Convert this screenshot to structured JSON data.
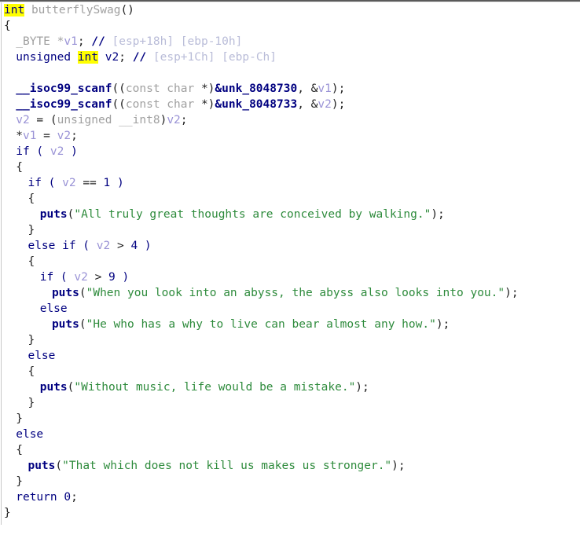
{
  "view": {
    "name": "hex-rays-pseudocode",
    "function_name": "butterflySwag",
    "background_color": "#ffffff",
    "highlight_color": "#ffff00",
    "string_color": "#2e8b3c",
    "keyword_color": "#000080",
    "variable_color": "#9a93d6",
    "comment_color": "#b9bcd8",
    "type_color": "#a0a0a0"
  },
  "code": {
    "lines": [
      {
        "indent": 0,
        "tokens": [
          {
            "t": "int",
            "c": "hl"
          },
          {
            "t": " ",
            "c": "plain"
          },
          {
            "t": "butterflySwag",
            "c": "type"
          },
          {
            "t": "()",
            "c": "plain"
          }
        ]
      },
      {
        "indent": 0,
        "tokens": [
          {
            "t": "{",
            "c": "plain"
          }
        ]
      },
      {
        "indent": 1,
        "tokens": [
          {
            "t": "_BYTE *",
            "c": "type"
          },
          {
            "t": "v1",
            "c": "var"
          },
          {
            "t": "; ",
            "c": "plain"
          },
          {
            "t": "//",
            "c": "cmt-mark"
          },
          {
            "t": " [esp+18h] [ebp-10h]",
            "c": "cmt"
          }
        ]
      },
      {
        "indent": 1,
        "tokens": [
          {
            "t": "unsigned ",
            "c": "kw"
          },
          {
            "t": "int",
            "c": "hl"
          },
          {
            "t": " ",
            "c": "plain"
          },
          {
            "t": "v2",
            "c": "kw"
          },
          {
            "t": "; ",
            "c": "plain"
          },
          {
            "t": "//",
            "c": "cmt-mark"
          },
          {
            "t": " [esp+1Ch] [ebp-Ch]",
            "c": "cmt"
          }
        ]
      },
      {
        "indent": 0,
        "tokens": [
          {
            "t": "",
            "c": "plain"
          }
        ]
      },
      {
        "indent": 1,
        "tokens": [
          {
            "t": "__isoc99_scanf",
            "c": "fn"
          },
          {
            "t": "((",
            "c": "plain"
          },
          {
            "t": "const char ",
            "c": "type"
          },
          {
            "t": "*)",
            "c": "plain"
          },
          {
            "t": "&unk_8048730",
            "c": "glob"
          },
          {
            "t": ", &",
            "c": "plain"
          },
          {
            "t": "v1",
            "c": "var"
          },
          {
            "t": ");",
            "c": "plain"
          }
        ]
      },
      {
        "indent": 1,
        "tokens": [
          {
            "t": "__isoc99_scanf",
            "c": "fn"
          },
          {
            "t": "((",
            "c": "plain"
          },
          {
            "t": "const char ",
            "c": "type"
          },
          {
            "t": "*)",
            "c": "plain"
          },
          {
            "t": "&unk_8048733",
            "c": "glob"
          },
          {
            "t": ", &",
            "c": "plain"
          },
          {
            "t": "v2",
            "c": "var"
          },
          {
            "t": ");",
            "c": "plain"
          }
        ]
      },
      {
        "indent": 1,
        "tokens": [
          {
            "t": "v2",
            "c": "var"
          },
          {
            "t": " = (",
            "c": "plain"
          },
          {
            "t": "unsigned __int8",
            "c": "type"
          },
          {
            "t": ")",
            "c": "plain"
          },
          {
            "t": "v2",
            "c": "var"
          },
          {
            "t": ";",
            "c": "plain"
          }
        ]
      },
      {
        "indent": 1,
        "tokens": [
          {
            "t": "*",
            "c": "plain"
          },
          {
            "t": "v1",
            "c": "var"
          },
          {
            "t": " = ",
            "c": "plain"
          },
          {
            "t": "v2",
            "c": "var"
          },
          {
            "t": ";",
            "c": "plain"
          }
        ]
      },
      {
        "indent": 1,
        "tokens": [
          {
            "t": "if ( ",
            "c": "kw"
          },
          {
            "t": "v2",
            "c": "var"
          },
          {
            "t": " )",
            "c": "kw"
          }
        ]
      },
      {
        "indent": 1,
        "tokens": [
          {
            "t": "{",
            "c": "plain"
          }
        ]
      },
      {
        "indent": 2,
        "tokens": [
          {
            "t": "if ( ",
            "c": "kw"
          },
          {
            "t": "v2",
            "c": "var"
          },
          {
            "t": " == ",
            "c": "plain"
          },
          {
            "t": "1",
            "c": "num"
          },
          {
            "t": " )",
            "c": "kw"
          }
        ]
      },
      {
        "indent": 2,
        "tokens": [
          {
            "t": "{",
            "c": "plain"
          }
        ]
      },
      {
        "indent": 3,
        "tokens": [
          {
            "t": "puts",
            "c": "fn"
          },
          {
            "t": "(",
            "c": "plain"
          },
          {
            "t": "\"All truly great thoughts are conceived by walking.\"",
            "c": "str"
          },
          {
            "t": ");",
            "c": "plain"
          }
        ]
      },
      {
        "indent": 2,
        "tokens": [
          {
            "t": "}",
            "c": "plain"
          }
        ]
      },
      {
        "indent": 2,
        "tokens": [
          {
            "t": "else if ( ",
            "c": "kw"
          },
          {
            "t": "v2",
            "c": "var"
          },
          {
            "t": " > ",
            "c": "plain"
          },
          {
            "t": "4",
            "c": "num"
          },
          {
            "t": " )",
            "c": "kw"
          }
        ]
      },
      {
        "indent": 2,
        "tokens": [
          {
            "t": "{",
            "c": "plain"
          }
        ]
      },
      {
        "indent": 3,
        "tokens": [
          {
            "t": "if ( ",
            "c": "kw"
          },
          {
            "t": "v2",
            "c": "var"
          },
          {
            "t": " > ",
            "c": "plain"
          },
          {
            "t": "9",
            "c": "num"
          },
          {
            "t": " )",
            "c": "kw"
          }
        ]
      },
      {
        "indent": 4,
        "tokens": [
          {
            "t": "puts",
            "c": "fn"
          },
          {
            "t": "(",
            "c": "plain"
          },
          {
            "t": "\"When you look into an abyss, the abyss also looks into you.\"",
            "c": "str"
          },
          {
            "t": ");",
            "c": "plain"
          }
        ]
      },
      {
        "indent": 3,
        "tokens": [
          {
            "t": "else",
            "c": "kw"
          }
        ]
      },
      {
        "indent": 4,
        "tokens": [
          {
            "t": "puts",
            "c": "fn"
          },
          {
            "t": "(",
            "c": "plain"
          },
          {
            "t": "\"He who has a why to live can bear almost any how.\"",
            "c": "str"
          },
          {
            "t": ");",
            "c": "plain"
          }
        ]
      },
      {
        "indent": 2,
        "tokens": [
          {
            "t": "}",
            "c": "plain"
          }
        ]
      },
      {
        "indent": 2,
        "tokens": [
          {
            "t": "else",
            "c": "kw"
          }
        ]
      },
      {
        "indent": 2,
        "tokens": [
          {
            "t": "{",
            "c": "plain"
          }
        ]
      },
      {
        "indent": 3,
        "tokens": [
          {
            "t": "puts",
            "c": "fn"
          },
          {
            "t": "(",
            "c": "plain"
          },
          {
            "t": "\"Without music, life would be a mistake.\"",
            "c": "str"
          },
          {
            "t": ");",
            "c": "plain"
          }
        ]
      },
      {
        "indent": 2,
        "tokens": [
          {
            "t": "}",
            "c": "plain"
          }
        ]
      },
      {
        "indent": 1,
        "tokens": [
          {
            "t": "}",
            "c": "plain"
          }
        ]
      },
      {
        "indent": 1,
        "tokens": [
          {
            "t": "else",
            "c": "kw"
          }
        ]
      },
      {
        "indent": 1,
        "tokens": [
          {
            "t": "{",
            "c": "plain"
          }
        ]
      },
      {
        "indent": 2,
        "tokens": [
          {
            "t": "puts",
            "c": "fn"
          },
          {
            "t": "(",
            "c": "plain"
          },
          {
            "t": "\"That which does not kill us makes us stronger.\"",
            "c": "str"
          },
          {
            "t": ");",
            "c": "plain"
          }
        ]
      },
      {
        "indent": 1,
        "tokens": [
          {
            "t": "}",
            "c": "plain"
          }
        ]
      },
      {
        "indent": 1,
        "tokens": [
          {
            "t": "return ",
            "c": "kw"
          },
          {
            "t": "0",
            "c": "num"
          },
          {
            "t": ";",
            "c": "plain"
          }
        ]
      },
      {
        "indent": 0,
        "tokens": [
          {
            "t": "}",
            "c": "plain"
          }
        ]
      }
    ]
  }
}
